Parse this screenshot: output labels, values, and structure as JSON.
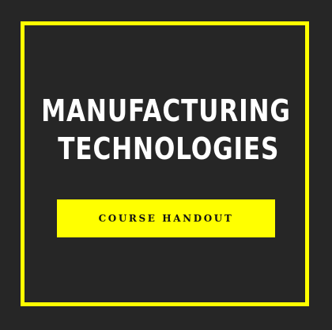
{
  "title": {
    "line1": "MANUFACTURING",
    "line2": "TECHNOLOGIES"
  },
  "badge": {
    "label": "COURSE HANDOUT"
  },
  "colors": {
    "background": "#262626",
    "accent": "#ffff00",
    "title_text": "#ffffff",
    "badge_text": "#111111"
  }
}
